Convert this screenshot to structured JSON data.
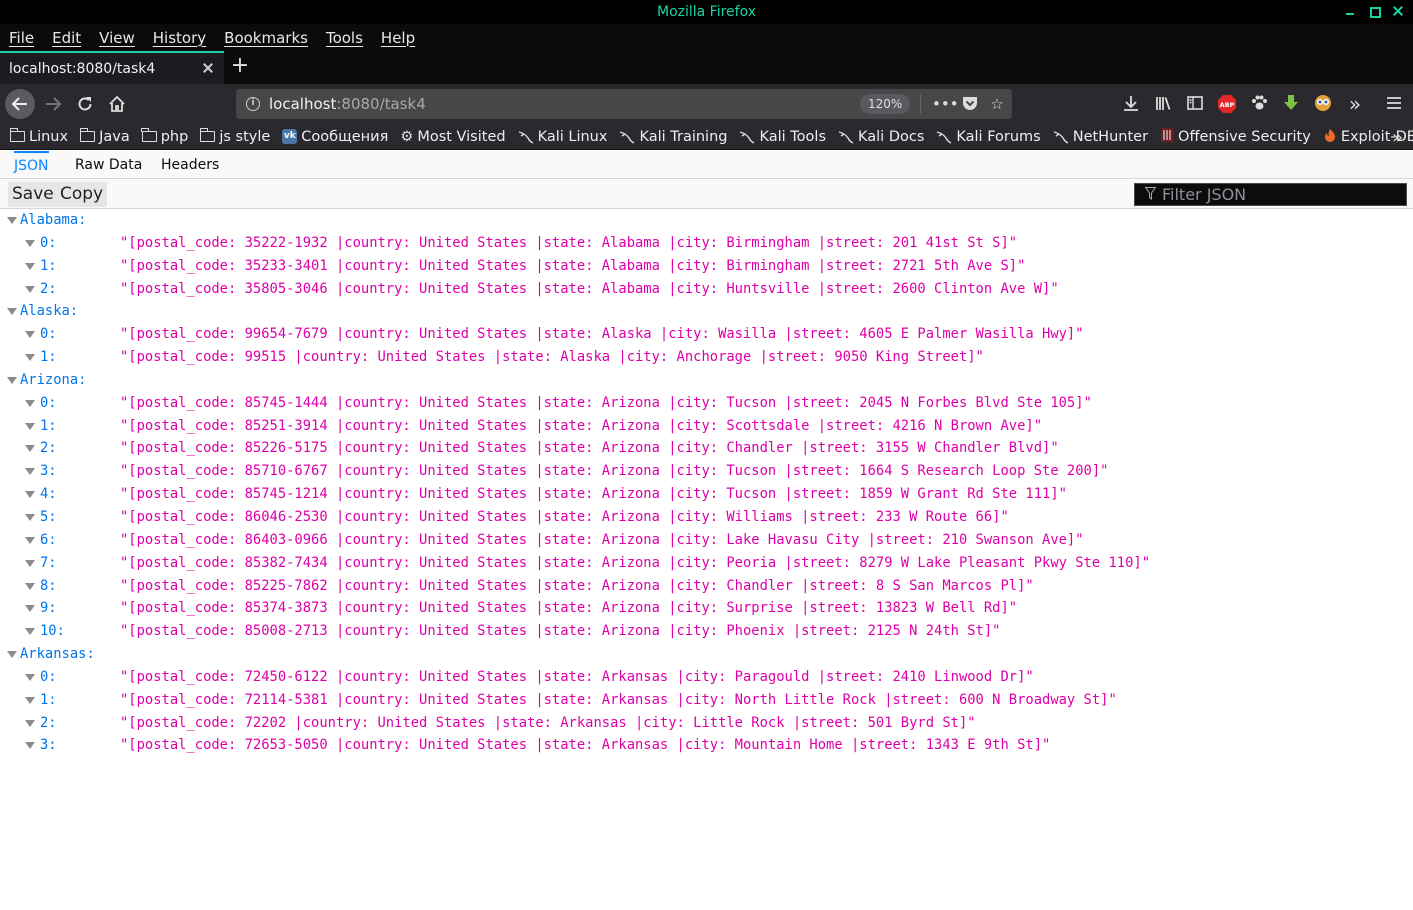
{
  "window": {
    "title": "Mozilla Firefox"
  },
  "menu": [
    "File",
    "Edit",
    "View",
    "History",
    "Bookmarks",
    "Tools",
    "Help"
  ],
  "tab": {
    "title": "localhost:8080/task4"
  },
  "urlbar": {
    "host": "localhost",
    "path": ":8080/task4",
    "zoom": "120%"
  },
  "bookmarks": [
    {
      "label": "Linux",
      "icon": "folder-icon"
    },
    {
      "label": "Java",
      "icon": "folder-icon"
    },
    {
      "label": "php",
      "icon": "folder-icon"
    },
    {
      "label": "js style",
      "icon": "folder-icon"
    },
    {
      "label": "Сообщения",
      "icon": "vk-icon"
    },
    {
      "label": "Most Visited",
      "icon": "gear-icon"
    },
    {
      "label": "Kali Linux",
      "icon": "kali-dragon-icon"
    },
    {
      "label": "Kali Training",
      "icon": "kali-dragon-icon"
    },
    {
      "label": "Kali Tools",
      "icon": "kali-dragon-icon"
    },
    {
      "label": "Kali Docs",
      "icon": "kali-dragon-icon"
    },
    {
      "label": "Kali Forums",
      "icon": "kali-dragon-icon"
    },
    {
      "label": "NetHunter",
      "icon": "kali-dragon-icon"
    },
    {
      "label": "Offensive Security",
      "icon": "offsec-icon"
    },
    {
      "label": "Exploit-DB",
      "icon": "exploitdb-icon"
    }
  ],
  "json_viewer": {
    "tabs": [
      "JSON",
      "Raw Data",
      "Headers"
    ],
    "save_label": "Save",
    "copy_label": "Copy",
    "filter_placeholder": "Filter JSON"
  },
  "tree": [
    {
      "key": "Alabama:",
      "items": [
        "\"[postal_code: 35222-1932 |country: United States |state: Alabama |city: Birmingham |street: 201 41st St S]\"",
        "\"[postal_code: 35233-3401 |country: United States |state: Alabama |city: Birmingham |street: 2721 5th Ave S]\"",
        "\"[postal_code: 35805-3046 |country: United States |state: Alabama |city: Huntsville |street: 2600 Clinton Ave W]\""
      ]
    },
    {
      "key": "Alaska:",
      "items": [
        "\"[postal_code: 99654-7679 |country: United States |state: Alaska |city: Wasilla |street: 4605 E Palmer Wasilla Hwy]\"",
        "\"[postal_code: 99515 |country: United States |state: Alaska |city: Anchorage |street: 9050 King Street]\""
      ]
    },
    {
      "key": "Arizona:",
      "items": [
        "\"[postal_code: 85745-1444 |country: United States |state: Arizona |city: Tucson |street: 2045 N Forbes Blvd Ste 105]\"",
        "\"[postal_code: 85251-3914 |country: United States |state: Arizona |city: Scottsdale |street: 4216 N Brown Ave]\"",
        "\"[postal_code: 85226-5175 |country: United States |state: Arizona |city: Chandler |street: 3155 W Chandler Blvd]\"",
        "\"[postal_code: 85710-6767 |country: United States |state: Arizona |city: Tucson |street: 1664 S Research Loop Ste 200]\"",
        "\"[postal_code: 85745-1214 |country: United States |state: Arizona |city: Tucson |street: 1859 W Grant Rd Ste 111]\"",
        "\"[postal_code: 86046-2530 |country: United States |state: Arizona |city: Williams |street: 233 W Route 66]\"",
        "\"[postal_code: 86403-0966 |country: United States |state: Arizona |city: Lake Havasu City |street: 210 Swanson Ave]\"",
        "\"[postal_code: 85382-7434 |country: United States |state: Arizona |city: Peoria |street: 8279 W Lake Pleasant Pkwy Ste 110]\"",
        "\"[postal_code: 85225-7862 |country: United States |state: Arizona |city: Chandler |street: 8 S San Marcos Pl]\"",
        "\"[postal_code: 85374-3873 |country: United States |state: Arizona |city: Surprise |street: 13823 W Bell Rd]\"",
        "\"[postal_code: 85008-2713 |country: United States |state: Arizona |city: Phoenix |street: 2125 N 24th St]\""
      ]
    },
    {
      "key": "Arkansas:",
      "items": [
        "\"[postal_code: 72450-6122 |country: United States |state: Arkansas |city: Paragould |street: 2410 Linwood Dr]\"",
        "\"[postal_code: 72114-5381 |country: United States |state: Arkansas |city: North Little Rock |street: 600 N Broadway St]\"",
        "\"[postal_code: 72202 |country: United States |state: Arkansas |city: Little Rock |street: 501 Byrd St]\"",
        "\"[postal_code: 72653-5050 |country: United States |state: Arkansas |city: Mountain Home |street: 1343 E 9th St]\""
      ]
    }
  ]
}
